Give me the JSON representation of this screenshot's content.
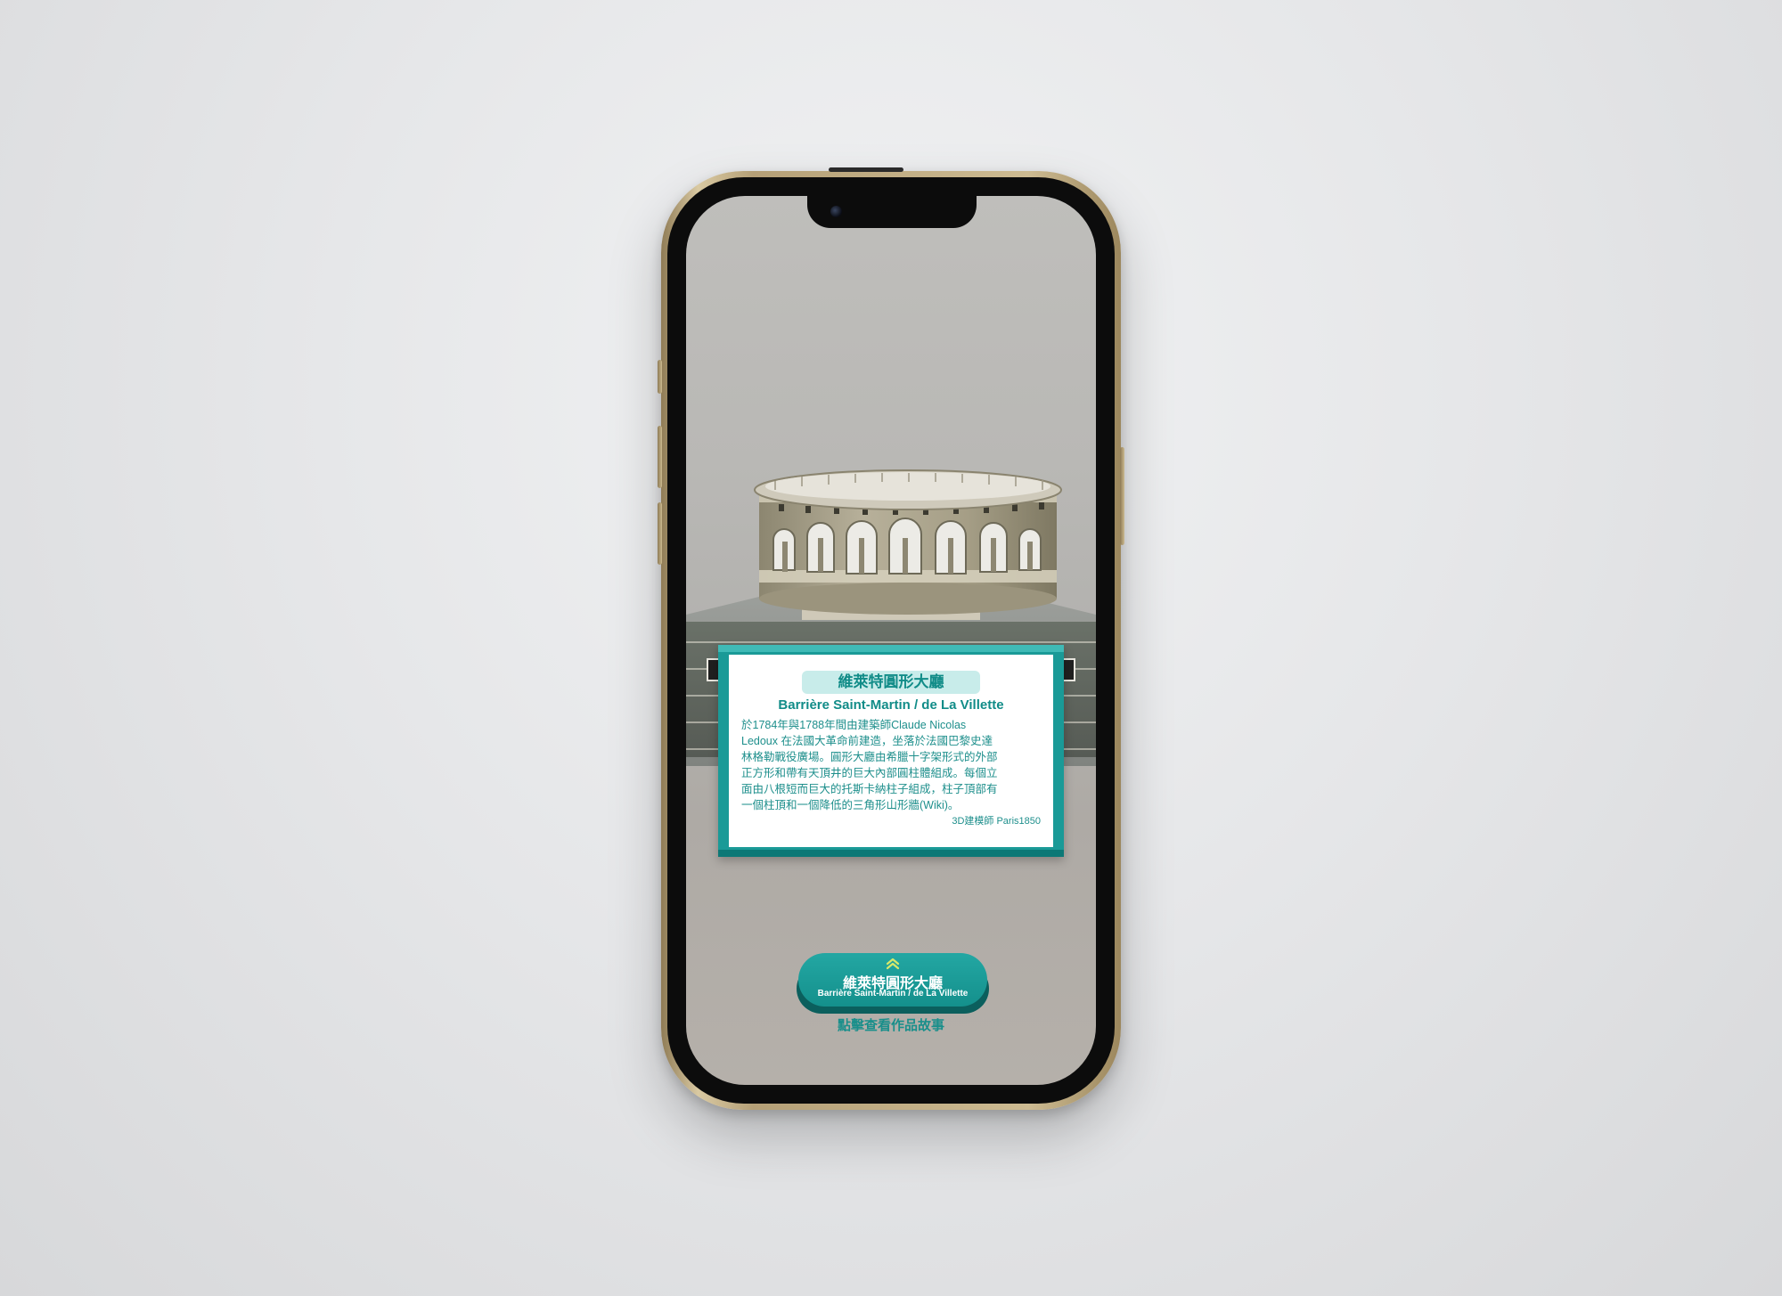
{
  "card": {
    "title_zh": "維萊特圓形大廳",
    "title_en": "Barrière Saint-Martin / de La Villette",
    "body_lines": [
      "於1784年與1788年間由建築師Claude Nicolas",
      "Ledoux 在法國大革命前建造，坐落於法國巴黎史達",
      "林格勒戰役廣場。圓形大廳由希臘十字架形式的外部",
      "正方形和帶有天頂井的巨大內部圓柱體組成。每個立",
      "面由八根短而巨大的托斯卡納柱子組成，柱子頂部有",
      "一個柱頂和一個降低的三角形山形牆(Wiki)。"
    ],
    "credit": "3D建模師  Paris1850"
  },
  "cta": {
    "title_zh": "維萊特圓形大廳",
    "title_en": "Barrière Saint-Martin / de La Villette",
    "icon": "chevron-double-up-icon",
    "hint": "點擊查看作品故事"
  },
  "colors": {
    "accent": "#1a9a97",
    "accent_light": "#c8ecea",
    "chevron": "#d8e86a",
    "phone_frame": "#c9b78e"
  }
}
